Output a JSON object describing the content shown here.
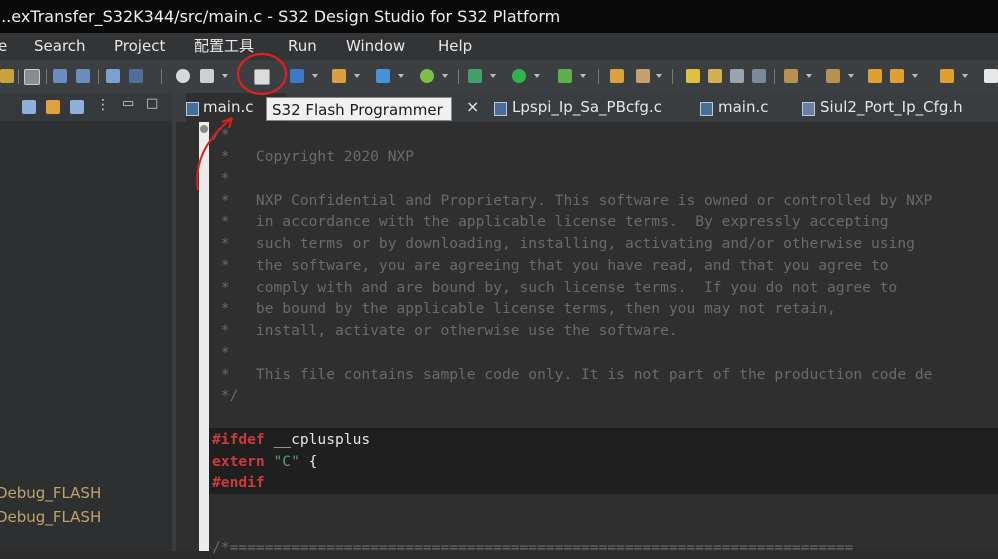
{
  "window": {
    "title": "...exTransfer_S32K344/src/main.c - S32 Design Studio for S32 Platform"
  },
  "menubar": {
    "items": [
      "e",
      "Search",
      "Project",
      "配置工具",
      "Run",
      "Window",
      "Help"
    ]
  },
  "left_panel": {
    "items": [
      "Debug_FLASH",
      "Debug_FLASH"
    ]
  },
  "tooltip": {
    "text": "S32 Flash Programmer"
  },
  "tabs": [
    {
      "label": "main.c",
      "active": true
    },
    {
      "label": "Lpspi_Ip_Sa_PBcfg.c",
      "active": false
    },
    {
      "label": "main.c",
      "active": false
    },
    {
      "label": "Siul2_Port_Ip_Cfg.h",
      "active": false
    }
  ],
  "tab_close_glyph": "×",
  "editor": {
    "comment_lines": [
      "/*",
      " *   Copyright 2020 NXP",
      " *",
      " *   NXP Confidential and Proprietary. This software is owned or controlled by NXP",
      " *   in accordance with the applicable license terms.  By expressly accepting",
      " *   such terms or by downloading, installing, activating and/or otherwise using",
      " *   the software, you are agreeing that you have read, and that you agree to",
      " *   comply with and are bound by, such license terms.  If you do not agree to",
      " *   be bound by the applicable license terms, then you may not retain,",
      " *   install, activate or otherwise use the software.",
      " *",
      " *   This file contains sample code only. It is not part of the production code de",
      " */"
    ],
    "ifdef_kw": "#ifdef",
    "ifdef_sym": " __cplusplus",
    "extern_kw": "extern",
    "extern_str": " \"C\"",
    "extern_brace": " {",
    "endif_kw": "#endif",
    "trailing_comment": "/*======================================================================="
  },
  "colors": {
    "annotation": "#e0201a",
    "keyword": "#cc3b3b",
    "string": "#5aa06a",
    "comment": "#6a6a6a"
  },
  "icons": [
    "new-file-icon",
    "save-icon",
    "undo-icon",
    "redo-icon",
    "build-icon",
    "debug-icon",
    "flash-programmer-icon",
    "run-icon",
    "search-icon",
    "settings-icon"
  ]
}
